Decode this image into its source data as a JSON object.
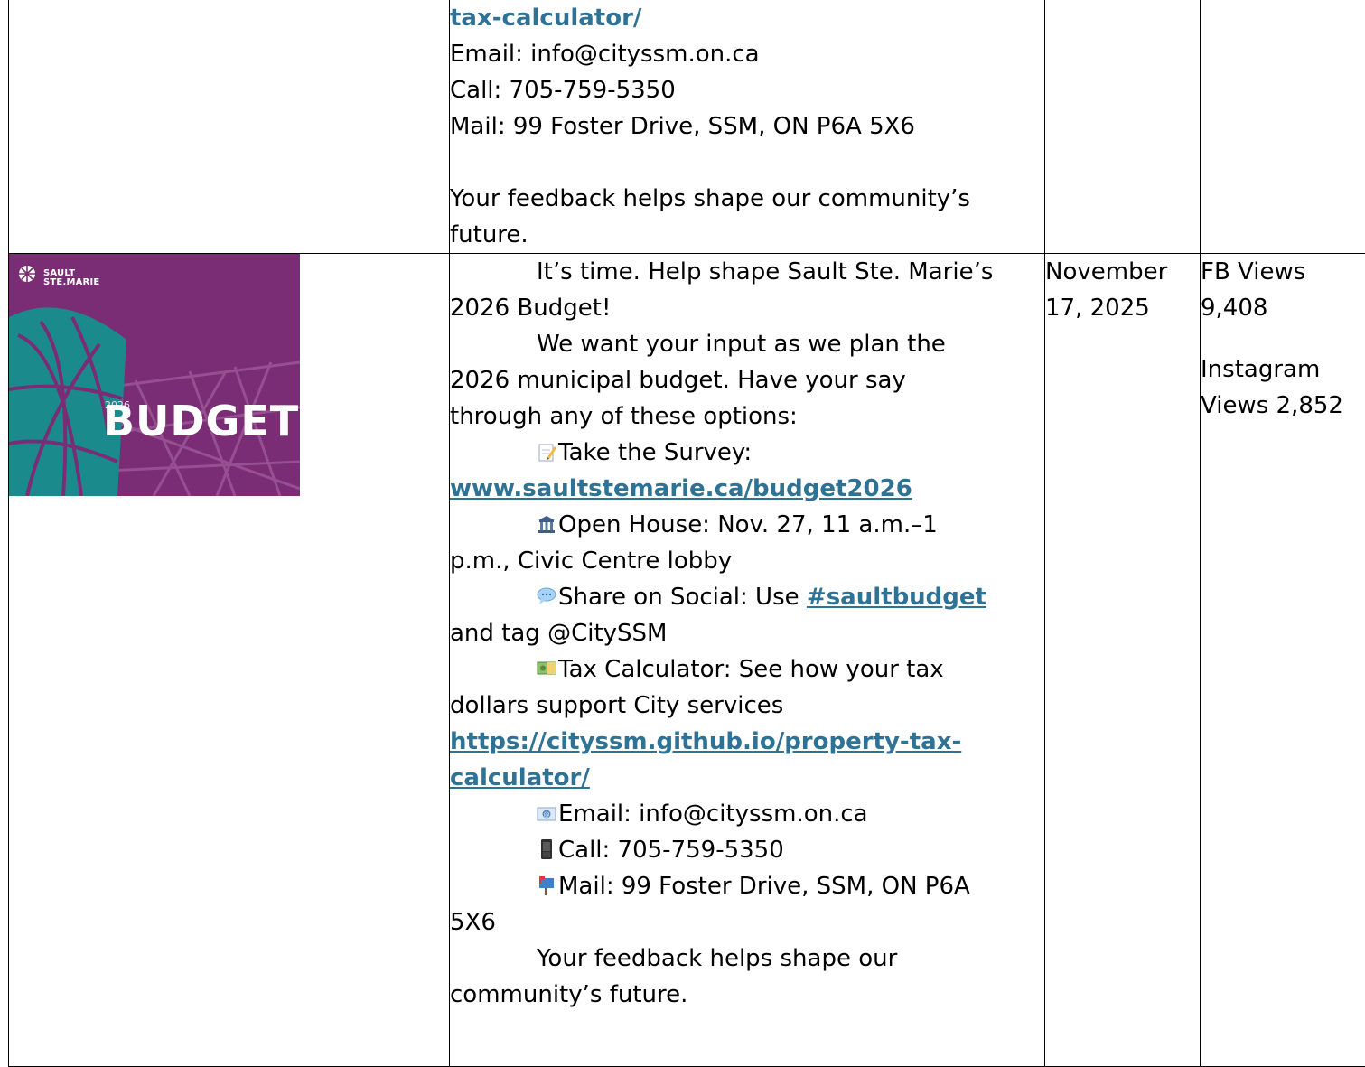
{
  "row1": {
    "link_tail": "tax-calculator/",
    "email": "Email: info@cityssm.on.ca",
    "call": "Call: 705-759-5350",
    "mail": "Mail: 99 Foster Drive, SSM, ON P6A 5X6",
    "feedback_1": "Your feedback helps shape our community’s",
    "feedback_2": "future."
  },
  "row2": {
    "image": {
      "logo_line1": "SAULT",
      "logo_line2": "STE.MARIE",
      "year": "2026",
      "word": "BUDGET",
      "colors": {
        "background": "#7a2d74",
        "teal": "#1b8a8c"
      }
    },
    "post": {
      "intro_1": "It’s time. Help shape Sault Ste. Marie’s",
      "intro_2": "2026 Budget!",
      "body_1": "We want your input as we plan the",
      "body_2": "2026 municipal budget. Have your say",
      "body_3": "through any of these options:",
      "survey_label": "Take the Survey:",
      "survey_link": "www.saultstemarie.ca/budget2026",
      "open_house_1": "Open House: Nov. 27, 11 a.m.–1",
      "open_house_2": "p.m., Civic Centre lobby",
      "social_prefix": "Share on Social: Use ",
      "social_hashtag": "#saultbudget",
      "social_2": "and tag @CitySSM",
      "tax_1": "Tax Calculator: See how your tax",
      "tax_2": "dollars support City services",
      "tax_link_1": "https://cityssm.github.io/property-tax-",
      "tax_link_2": "calculator/",
      "email": "Email: info@cityssm.on.ca",
      "call": "Call: 705-759-5350",
      "mail_1": "Mail: 99 Foster Drive, SSM, ON P6A",
      "mail_2": "5X6",
      "feedback_1": "Your feedback helps shape our",
      "feedback_2": "community’s future.",
      "icons": [
        "memo-icon",
        "classical-building-icon",
        "speech-balloon-icon",
        "money-icon",
        "email-icon",
        "mobile-phone-icon",
        "mailbox-icon"
      ]
    },
    "date_1": "November",
    "date_2": "17, 2025",
    "stats": {
      "fb_1": "FB Views",
      "fb_2": "9,408",
      "ig_1": "Instagram",
      "ig_2": "Views 2,852"
    }
  },
  "colors": {
    "link": "#2e7396"
  }
}
